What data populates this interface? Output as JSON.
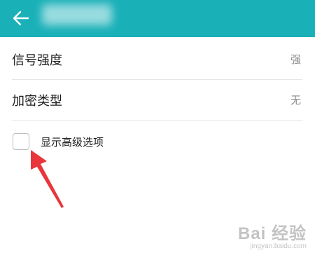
{
  "header": {
    "back_icon": "arrow-left-icon",
    "background_color": "#1ab0b8"
  },
  "settings": [
    {
      "label": "信号强度",
      "value": "强"
    },
    {
      "label": "加密类型",
      "value": "无"
    }
  ],
  "advanced_option": {
    "label": "显示高级选项",
    "checked": false
  },
  "annotation": {
    "arrow_color": "#e8363c"
  },
  "watermark": {
    "brand": "Bai 经验",
    "url": "jingyan.baidu.com"
  }
}
